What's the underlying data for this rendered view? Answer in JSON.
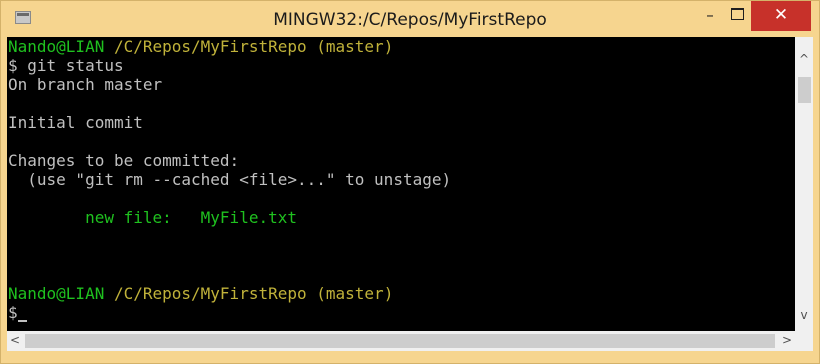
{
  "window": {
    "title": "MINGW32:/C/Repos/MyFirstRepo",
    "minimize_label": "–",
    "close_label": "✕"
  },
  "terminal": {
    "lines": [
      {
        "user": "Nando@LIAN",
        "path": " /C/Repos/MyFirstRepo",
        "branch": " (master)"
      },
      {
        "text": "$ git status"
      },
      {
        "text": "On branch master"
      },
      {
        "text": ""
      },
      {
        "text": "Initial commit"
      },
      {
        "text": ""
      },
      {
        "text": "Changes to be committed:"
      },
      {
        "text": "  (use \"git rm --cached <file>...\" to unstage)"
      },
      {
        "text": ""
      },
      {
        "staged": "        new file:   MyFile.txt"
      },
      {
        "text": ""
      },
      {
        "text": ""
      },
      {
        "text": ""
      },
      {
        "user": "Nando@LIAN",
        "path": " /C/Repos/MyFirstRepo",
        "branch": " (master)"
      },
      {
        "text": "$"
      }
    ],
    "colors": {
      "background": "#000000",
      "text": "#c0c0c0",
      "user": "#1fc11f",
      "path": "#c0b23a",
      "staged": "#1fc11f"
    }
  },
  "scrollbars": {
    "up_icon": "chevron-up-icon",
    "down_icon": "chevron-down-icon",
    "left_icon": "chevron-left-icon",
    "right_icon": "chevron-right-icon"
  }
}
